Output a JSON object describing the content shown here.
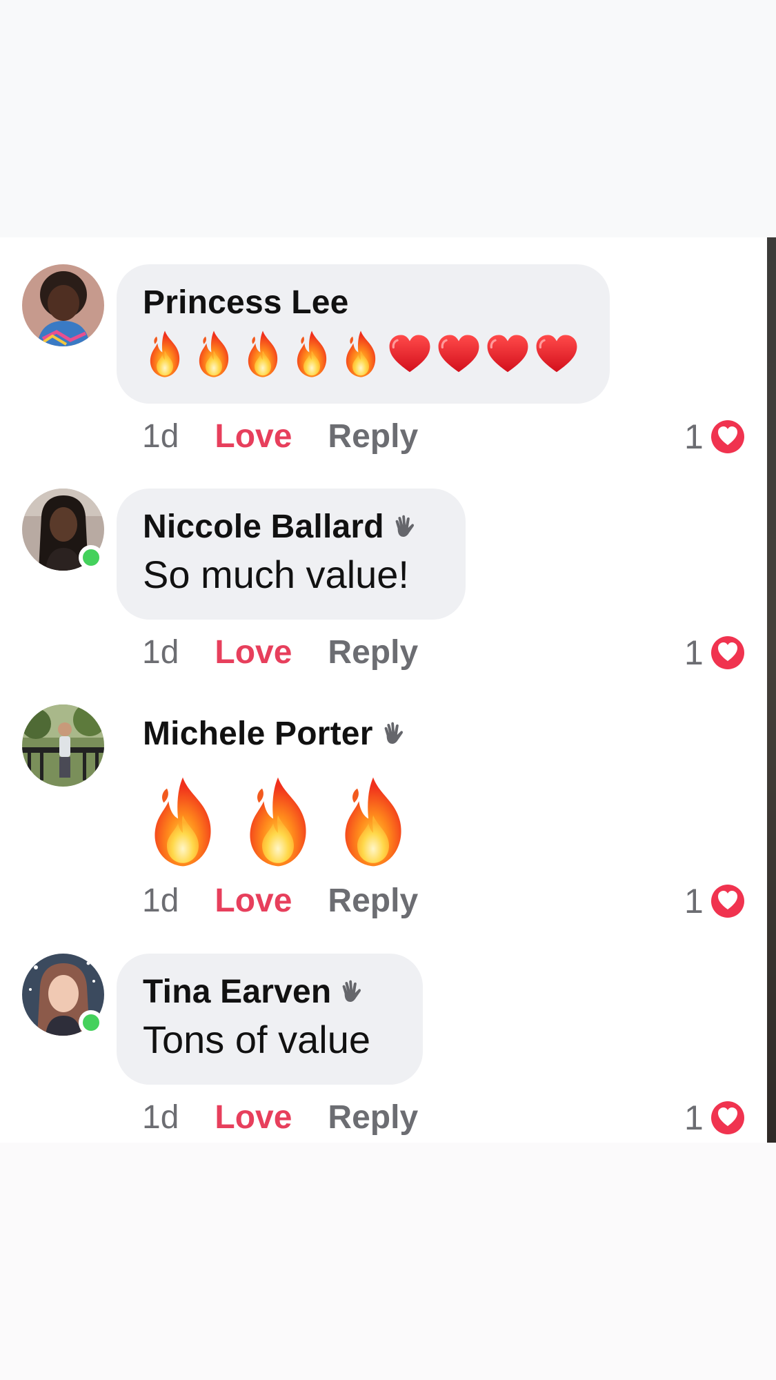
{
  "colors": {
    "love": "#e73f5c",
    "muted": "#6c6d72",
    "bubble": "#eff0f3",
    "online": "#44d15c"
  },
  "comments": [
    {
      "author": "Princess Lee",
      "badge_icon": "",
      "text": "",
      "emoji": [
        "fire",
        "fire",
        "fire",
        "fire",
        "fire",
        "heart",
        "heart",
        "heart",
        "heart"
      ],
      "online": false,
      "time": "1d",
      "love_label": "Love",
      "reply_label": "Reply",
      "reaction_count": "1",
      "reaction_icon": "love-reaction-icon"
    },
    {
      "author": "Niccole Ballard",
      "badge_icon": "wave-icon",
      "text": "So much value!",
      "emoji": [],
      "online": true,
      "time": "1d",
      "love_label": "Love",
      "reply_label": "Reply",
      "reaction_count": "1",
      "reaction_icon": "love-reaction-icon"
    },
    {
      "author": "Michele Porter",
      "badge_icon": "wave-icon",
      "text": "",
      "emoji": [
        "fire",
        "fire",
        "fire"
      ],
      "online": false,
      "time": "1d",
      "love_label": "Love",
      "reply_label": "Reply",
      "reaction_count": "1",
      "reaction_icon": "love-reaction-icon"
    },
    {
      "author": "Tina Earven",
      "badge_icon": "wave-icon",
      "text": "Tons of value",
      "emoji": [],
      "online": true,
      "time": "1d",
      "love_label": "Love",
      "reply_label": "Reply",
      "reaction_count": "1",
      "reaction_icon": "love-reaction-icon"
    }
  ]
}
